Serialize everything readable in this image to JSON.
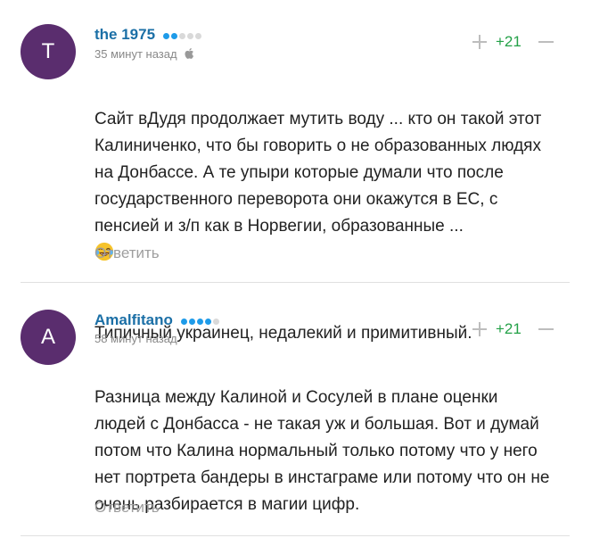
{
  "comments": [
    {
      "avatar_letter": "T",
      "avatar_color": "#5a2d6e",
      "username": "the 1975",
      "timestamp": "35 минут назад",
      "rating_level": 2,
      "rating_max": 5,
      "rating": "+21",
      "text": "Сайт вДудя продолжает мутить воду ... кто он такой этот\nКалиниченко, что бы говорить о не образованных людях\nна Донбассе. А те упыри которые думали что после\nгосударственного переворота они окажутся в ЕС, с\nпенсией и з/п как в Норвегии, образованные ...",
      "text_after_emoji": "Типичный украинец, недалекий и примитивный.",
      "emoji_icon": "tears-of-joy-emoji-icon",
      "device_icon": "apple-icon",
      "reply_label": "Ответить"
    },
    {
      "avatar_letter": "A",
      "avatar_color": "#5a2d6e",
      "username": "Amalfitano",
      "timestamp": "58 минут назад",
      "rating_level": 4,
      "rating_max": 5,
      "rating": "+21",
      "text": "Разница между Калиной и Сосулей в плане оценки\nлюдей с Донбасса - не такая уж и большая. Вот и думай\nпотом что Калина нормальный только потому что у него\nнет портрета бандеры в инстаграме или потому что он не\nочень разбирается в магии цифр.",
      "reply_label": "Ответить"
    }
  ],
  "colors": {
    "username": "#1b6fa6",
    "rating_positive": "#24a148",
    "dot_active": "#1e9be9",
    "dot_inactive": "#d9d9d9"
  }
}
